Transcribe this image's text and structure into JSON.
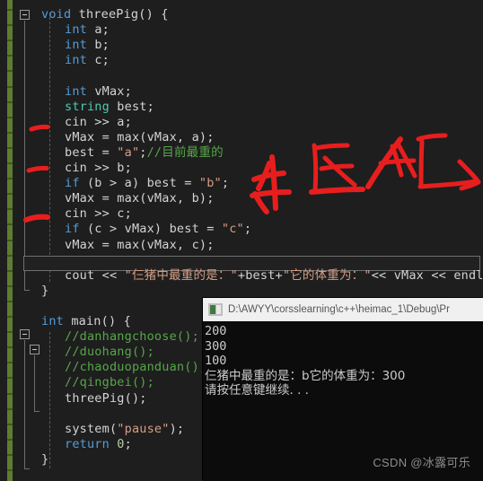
{
  "editor": {
    "name": "visual-studio-code-editor",
    "background": "#1e1e1e",
    "change_bar_color": "#5d7d31",
    "lines": [
      {
        "indent": 0,
        "segs": [
          {
            "t": "void ",
            "c": "kw"
          },
          {
            "t": "threePig",
            "c": "pl"
          },
          {
            "t": "() {",
            "c": "pl"
          }
        ]
      },
      {
        "indent": 1,
        "segs": [
          {
            "t": "int ",
            "c": "kw"
          },
          {
            "t": "a;",
            "c": "pl"
          }
        ]
      },
      {
        "indent": 1,
        "segs": [
          {
            "t": "int ",
            "c": "kw"
          },
          {
            "t": "b;",
            "c": "pl"
          }
        ]
      },
      {
        "indent": 1,
        "segs": [
          {
            "t": "int ",
            "c": "kw"
          },
          {
            "t": "c;",
            "c": "pl"
          }
        ]
      },
      {
        "indent": 1,
        "segs": []
      },
      {
        "indent": 1,
        "segs": [
          {
            "t": "int ",
            "c": "kw"
          },
          {
            "t": "vMax;",
            "c": "pl"
          }
        ]
      },
      {
        "indent": 1,
        "segs": [
          {
            "t": "string ",
            "c": "ty"
          },
          {
            "t": "best;",
            "c": "pl"
          }
        ]
      },
      {
        "indent": 1,
        "segs": [
          {
            "t": "cin >> a;",
            "c": "pl"
          }
        ]
      },
      {
        "indent": 1,
        "segs": [
          {
            "t": "vMax = max(vMax, a);",
            "c": "pl"
          }
        ]
      },
      {
        "indent": 1,
        "segs": [
          {
            "t": "best = ",
            "c": "pl"
          },
          {
            "t": "\"a\"",
            "c": "st"
          },
          {
            "t": ";",
            "c": "pl"
          },
          {
            "t": "//目前最重的",
            "c": "cm"
          }
        ]
      },
      {
        "indent": 1,
        "segs": [
          {
            "t": "cin >> b;",
            "c": "pl"
          }
        ]
      },
      {
        "indent": 1,
        "segs": [
          {
            "t": "if ",
            "c": "kw"
          },
          {
            "t": "(b > a) best = ",
            "c": "pl"
          },
          {
            "t": "\"b\"",
            "c": "st"
          },
          {
            "t": ";",
            "c": "pl"
          }
        ]
      },
      {
        "indent": 1,
        "segs": [
          {
            "t": "vMax = max(vMax, b);",
            "c": "pl"
          }
        ]
      },
      {
        "indent": 1,
        "segs": [
          {
            "t": "cin >> c;",
            "c": "pl"
          }
        ]
      },
      {
        "indent": 1,
        "segs": [
          {
            "t": "if ",
            "c": "kw"
          },
          {
            "t": "(c > vMax) best = ",
            "c": "pl"
          },
          {
            "t": "\"c\"",
            "c": "st"
          },
          {
            "t": ";",
            "c": "pl"
          }
        ]
      },
      {
        "indent": 1,
        "segs": [
          {
            "t": "vMax = max(vMax, c);",
            "c": "pl"
          }
        ]
      },
      {
        "indent": 1,
        "segs": []
      },
      {
        "indent": 1,
        "segs": [
          {
            "t": "cout << ",
            "c": "pl"
          },
          {
            "t": "\"仨猪中最重的是：\"",
            "c": "st"
          },
          {
            "t": "+best+",
            "c": "pl"
          },
          {
            "t": "\"它的体重为：\"",
            "c": "st"
          },
          {
            "t": "<< vMax << endl;",
            "c": "pl"
          }
        ]
      },
      {
        "indent": 0,
        "segs": [
          {
            "t": "}",
            "c": "pl"
          }
        ]
      },
      {
        "indent": 0,
        "segs": []
      },
      {
        "indent": 0,
        "segs": [
          {
            "t": "int ",
            "c": "kw"
          },
          {
            "t": "main() {",
            "c": "pl"
          }
        ]
      },
      {
        "indent": 1,
        "segs": [
          {
            "t": "//danhangchoose();",
            "c": "cm"
          }
        ]
      },
      {
        "indent": 1,
        "segs": [
          {
            "t": "//duohang();",
            "c": "cm"
          }
        ]
      },
      {
        "indent": 1,
        "segs": [
          {
            "t": "//chaoduopanduan();",
            "c": "cm"
          }
        ]
      },
      {
        "indent": 1,
        "segs": [
          {
            "t": "//qingbei();",
            "c": "cm"
          }
        ]
      },
      {
        "indent": 1,
        "segs": [
          {
            "t": "threePig();",
            "c": "pl"
          }
        ]
      },
      {
        "indent": 1,
        "segs": []
      },
      {
        "indent": 1,
        "segs": [
          {
            "t": "system(",
            "c": "pl"
          },
          {
            "t": "\"pause\"",
            "c": "st"
          },
          {
            "t": ");",
            "c": "pl"
          }
        ]
      },
      {
        "indent": 1,
        "segs": [
          {
            "t": "return ",
            "c": "kw"
          },
          {
            "t": "0",
            "c": "num"
          },
          {
            "t": ";",
            "c": "pl"
          }
        ]
      },
      {
        "indent": 0,
        "segs": [
          {
            "t": "}",
            "c": "pl"
          }
        ]
      }
    ]
  },
  "annotation": {
    "name": "red-marker-ink",
    "color": "#e81e1e",
    "strokes_label": "handwritten-chinese-red-marker",
    "underlines_label": "red-underline-marks-on-cin-lines"
  },
  "console": {
    "title": "D:\\AWYY\\corsslearning\\c++\\heimac_1\\Debug\\Pr",
    "icon": "console-app-icon",
    "output": [
      "200",
      "300",
      "100",
      "仨猪中最重的是：b它的体重为：300",
      "请按任意键继续. . ."
    ]
  },
  "watermark": {
    "text": "CSDN @冰露可乐"
  }
}
